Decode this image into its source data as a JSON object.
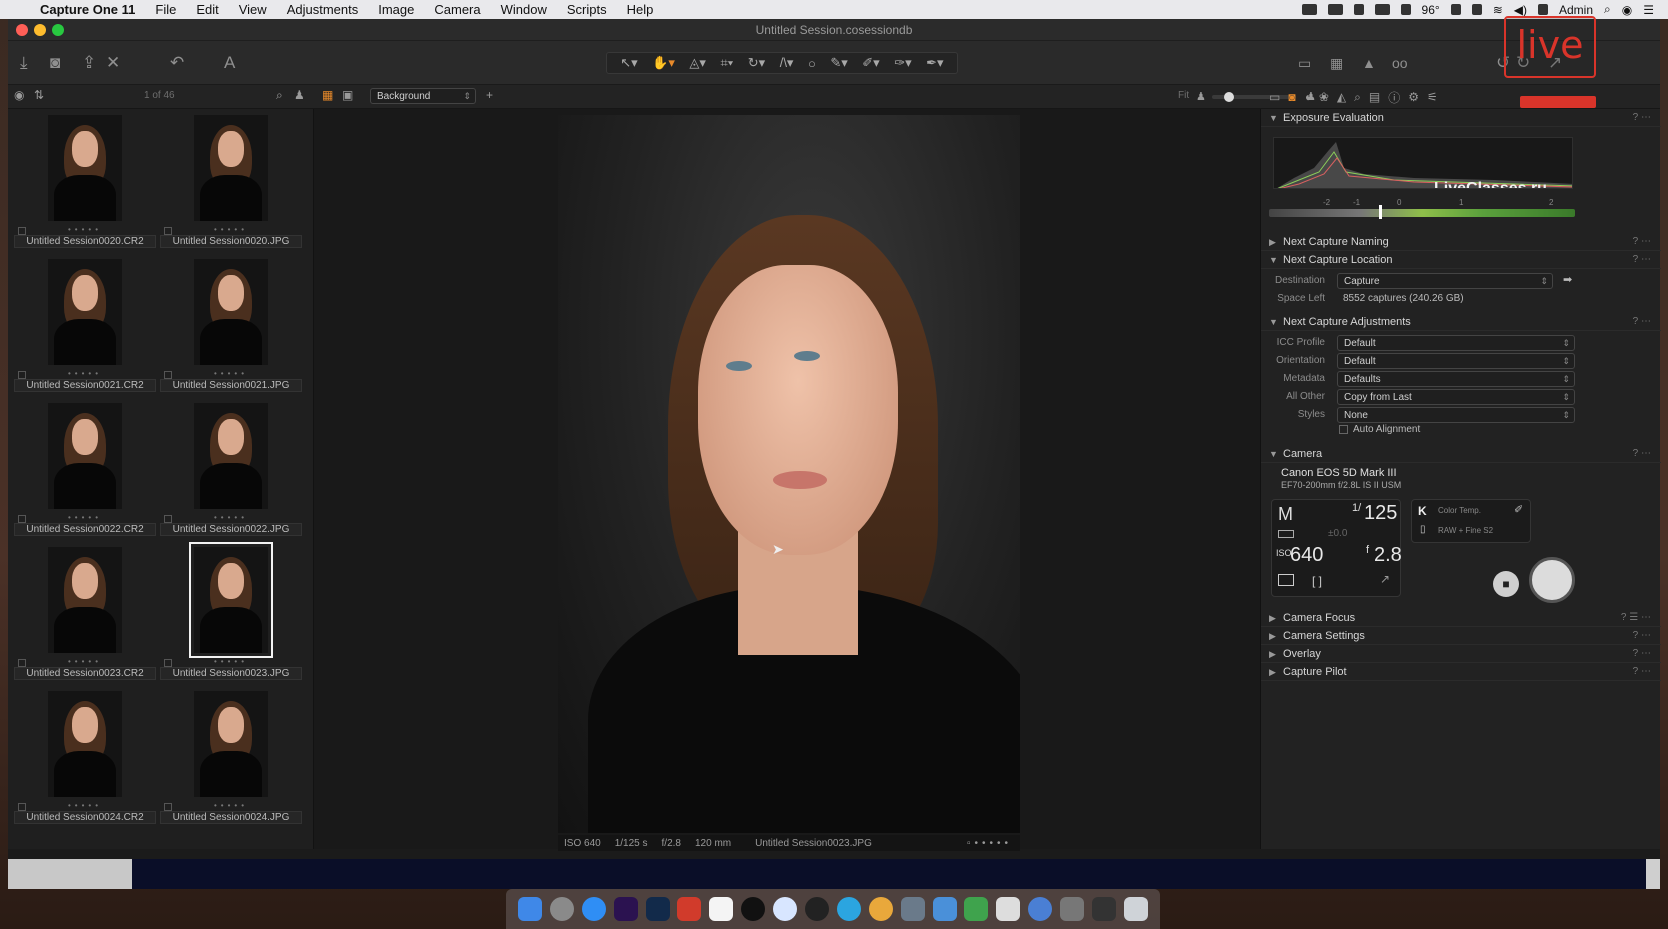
{
  "menubar": {
    "app_name": "Capture One 11",
    "items": [
      "File",
      "Edit",
      "View",
      "Adjustments",
      "Image",
      "Camera",
      "Window",
      "Scripts",
      "Help"
    ],
    "user": "Admin",
    "battery": "96°"
  },
  "window": {
    "title": "Untitled Session.cosessiondb"
  },
  "browser_bar": {
    "count": "1 of 46",
    "filter_select": "Background"
  },
  "thumbnails": [
    {
      "label": "Untitled Session0020.CR2"
    },
    {
      "label": "Untitled Session0020.JPG"
    },
    {
      "label": "Untitled Session0021.CR2"
    },
    {
      "label": "Untitled Session0021.JPG"
    },
    {
      "label": "Untitled Session0022.CR2"
    },
    {
      "label": "Untitled Session0022.JPG"
    },
    {
      "label": "Untitled Session0023.CR2"
    },
    {
      "label": "Untitled Session0023.JPG",
      "selected": true
    },
    {
      "label": "Untitled Session0024.CR2"
    },
    {
      "label": "Untitled Session0024.JPG"
    }
  ],
  "viewer": {
    "fit_label": "Fit",
    "info": {
      "iso": "ISO 640",
      "shutter": "1/125 s",
      "aperture": "f/2.8",
      "focal": "120 mm",
      "file": "Untitled Session0023.JPG"
    }
  },
  "tools": {
    "exposure_evaluation": "Exposure Evaluation",
    "scale_ticks": [
      "-2",
      "-1",
      "0",
      "1",
      "2"
    ],
    "watermark": "LiveClasses.ru",
    "logo_text": "live",
    "next_capture_naming": "Next Capture Naming",
    "next_capture_location": "Next Capture Location",
    "destination_label": "Destination",
    "destination_value": "Capture",
    "space_left_label": "Space Left",
    "space_left_value": "8552 captures (240.26 GB)",
    "next_capture_adjustments": "Next Capture Adjustments",
    "icc_label": "ICC Profile",
    "icc_value": "Default",
    "orientation_label": "Orientation",
    "orientation_value": "Default",
    "metadata_label": "Metadata",
    "metadata_value": "Defaults",
    "allother_label": "All Other",
    "allother_value": "Copy from Last",
    "styles_label": "Styles",
    "styles_value": "None",
    "auto_alignment": "Auto Alignment",
    "camera": "Camera",
    "camera_model": "Canon EOS 5D Mark III",
    "lens": "EF70-200mm f/2.8L IS II USM",
    "mode": "M",
    "shutter": "125",
    "shutter_prefix": "1/",
    "ev": "±0.0",
    "iso": "640",
    "aperture": "2.8",
    "aperture_prefix": "f",
    "wb_letter": "K",
    "wb_label": "Color Temp.",
    "format_label": "RAW + Fine S2",
    "camera_focus": "Camera Focus",
    "camera_settings": "Camera Settings",
    "overlay": "Overlay",
    "capture_pilot": "Capture Pilot"
  },
  "colors": {
    "accent": "#e88a2a",
    "logo": "#d9342a"
  }
}
